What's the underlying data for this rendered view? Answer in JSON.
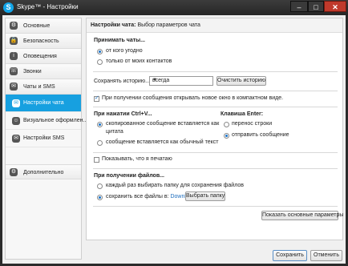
{
  "window": {
    "logo_letter": "S",
    "title": "Skype™ - Настройки",
    "min_glyph": "–",
    "max_glyph": "□",
    "close_glyph": "✕"
  },
  "sidebar": {
    "items": [
      {
        "label": "Основные",
        "icon": "⚙"
      },
      {
        "label": "Безопасность",
        "icon": "🔒"
      },
      {
        "label": "Оповещения",
        "icon": "i"
      },
      {
        "label": "Звонки",
        "icon": "☏"
      },
      {
        "label": "Чаты и SMS",
        "icon": "✉"
      },
      {
        "label": "Настройки чата",
        "icon": "✉"
      },
      {
        "label": "Визуальное оформлен...",
        "icon": "☺"
      },
      {
        "label": "Настройки SMS",
        "icon": "✉"
      },
      {
        "label": "Дополнительно",
        "icon": "⚙"
      }
    ]
  },
  "header": {
    "title_bold": "Настройки чата:",
    "title_rest": " Выбор параметров чата"
  },
  "accept_chats": {
    "heading": "Принимать чаты...",
    "options": [
      "от кого угодно",
      "только от моих контактов"
    ]
  },
  "history": {
    "label": "Сохранять историю...",
    "selected": "всегда",
    "clear_button": "Очистить историю"
  },
  "compact_window": {
    "label": "При получении сообщения открывать новое окно в компактном виде."
  },
  "ctrl_v": {
    "heading": "При нажатии Ctrl+V...",
    "option1_line1": "скопированное сообщение вставляется как",
    "option1_line2": "цитата",
    "option2": "сообщение вставляется как обычный текст"
  },
  "enter_key": {
    "heading": "Клавиша Enter:",
    "options": [
      "перенос строки",
      "отправить сообщение"
    ]
  },
  "typing": {
    "label": "Показывать, что я печатаю"
  },
  "files": {
    "heading": "При получении файлов...",
    "option1": "каждый раз выбирать папку для сохранения файлов",
    "option2_prefix": "сохранить все файлы в:",
    "folder": "Downloads",
    "choose_button": "Выбрать папку"
  },
  "show_basic_button": "Показать основные параметры",
  "footer": {
    "save": "Сохранить",
    "cancel": "Отменить"
  }
}
